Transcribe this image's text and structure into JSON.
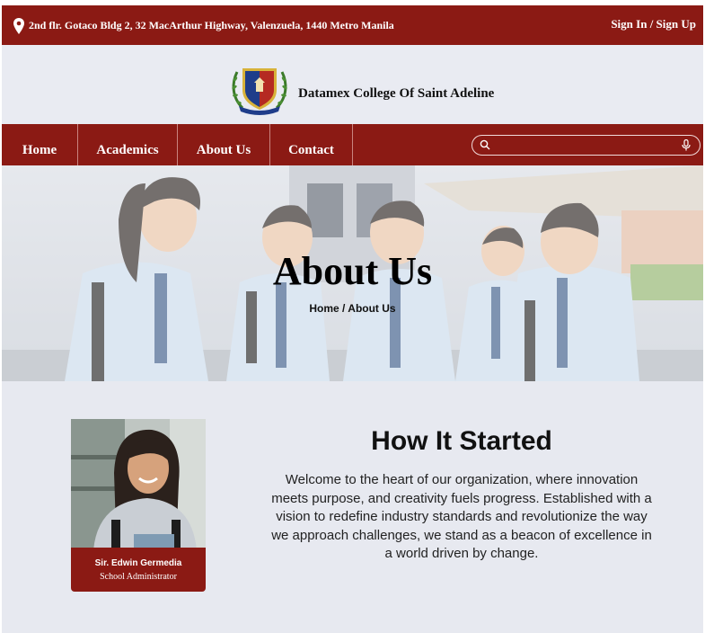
{
  "topbar": {
    "address": "2nd flr. Gotaco Bldg 2, 32 MacArthur Highway, Valenzuela, 1440 Metro Manila",
    "auth_link": "Sign In / Sign Up",
    "location_icon": "map-pin-icon"
  },
  "brand": {
    "school_name": "Datamex College Of Saint Adeline",
    "crest_icon": "school-crest-logo"
  },
  "nav": {
    "items": [
      {
        "label": "Home"
      },
      {
        "label": "Academics"
      },
      {
        "label": "About Us"
      },
      {
        "label": "Contact"
      }
    ],
    "search": {
      "placeholder": "",
      "search_icon": "search-icon",
      "mic_icon": "microphone-icon"
    }
  },
  "hero": {
    "title": "About Us",
    "breadcrumb": "Home / About Us"
  },
  "profile": {
    "name": "Sir. Edwin Germedia",
    "role": "School Administrator"
  },
  "section": {
    "title": "How It Started",
    "body": "Welcome to the heart of our organization, where innovation meets purpose, and creativity fuels progress. Established with a vision to redefine industry standards and revolutionize the way we approach challenges, we stand as a beacon of excellence in a world driven by change."
  },
  "colors": {
    "brand_red": "#8b1a14",
    "page_bg": "#e7e9f0"
  }
}
